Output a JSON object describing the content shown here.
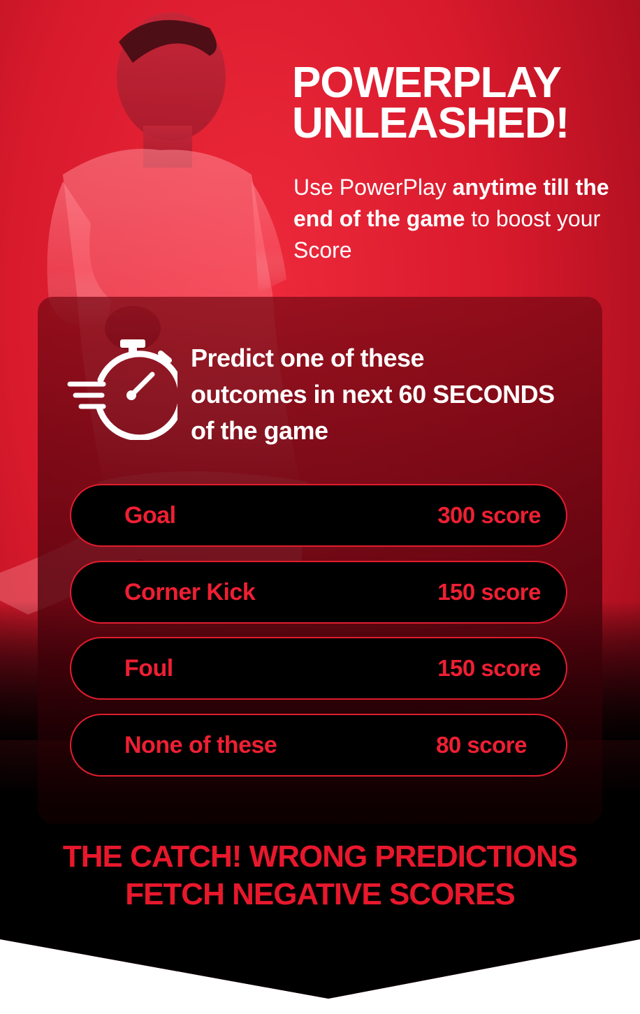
{
  "header": {
    "title_line1": "POWERPLAY",
    "title_line2": "UNLEASHED!",
    "sub_part1": "Use PowerPlay ",
    "sub_bold": "anytime till the end of the game",
    "sub_part2": " to boost your Score"
  },
  "predict": {
    "icon": "stopwatch-icon",
    "text_line1": "Predict one of these",
    "text_line2": "outcomes in next 60 SECONDS",
    "text_line3": "of the game"
  },
  "options": [
    {
      "label": "Goal",
      "score": "300 score"
    },
    {
      "label": "Corner Kick",
      "score": "150 score"
    },
    {
      "label": "Foul",
      "score": "150 score"
    },
    {
      "label": "None of these",
      "score": "80 score"
    }
  ],
  "footer": {
    "line1": "THE CATCH! WRONG PREDICTIONS",
    "line2": "FETCH NEGATIVE SCORES"
  },
  "colors": {
    "brand_red": "#e11d2e",
    "background_black": "#000000",
    "text_white": "#ffffff"
  }
}
